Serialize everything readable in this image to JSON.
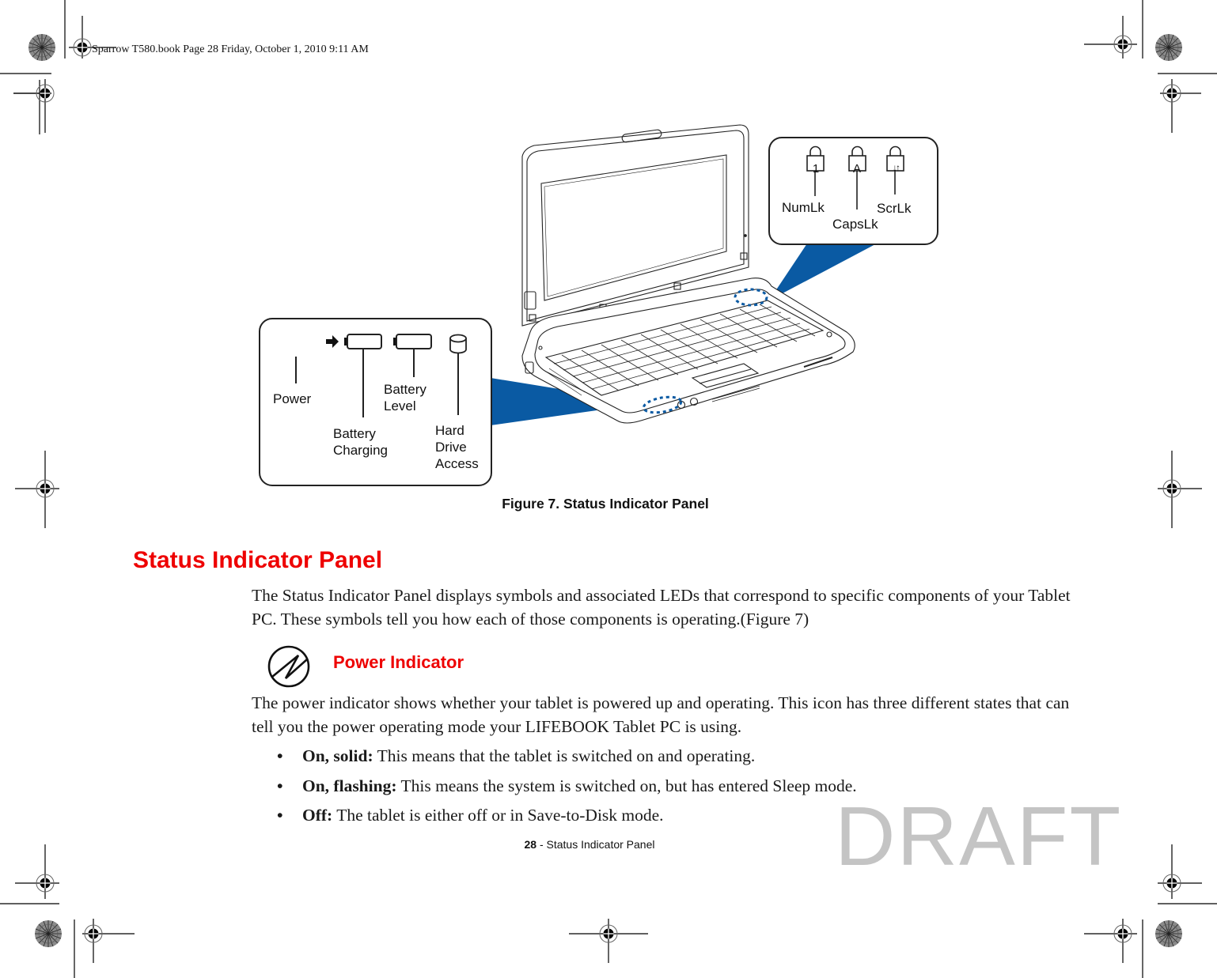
{
  "header": {
    "stamp": "Sparrow T580.book  Page 28  Friday, October 1, 2010  9:11 AM"
  },
  "figure": {
    "caption": "Figure 7.  Status Indicator Panel",
    "top_callout": {
      "icons": [
        "numlock-icon",
        "capslock-icon",
        "scrolllock-icon"
      ],
      "icon_glyphs": [
        "1",
        "A",
        "↓↑"
      ],
      "labels": {
        "numlk": "NumLk",
        "capslk": "CapsLk",
        "scrlk": "ScrLk"
      }
    },
    "bottom_callout": {
      "labels": {
        "power": "Power",
        "battery_charging_1": "Battery",
        "battery_charging_2": "Charging",
        "battery_level_1": "Battery",
        "battery_level_2": "Level",
        "hdd_1": "Hard",
        "hdd_2": "Drive",
        "hdd_3": "Access"
      }
    },
    "accent_color": "#0a5aa3"
  },
  "section": {
    "title": "Status Indicator Panel",
    "intro": "The Status Indicator Panel displays symbols and associated LEDs that correspond to specific components of your Tablet PC. These symbols tell you how each of those components is operating.(Figure 7)",
    "title_color": "#ee0000"
  },
  "subsection": {
    "icon": "power-indicator-icon",
    "title": "Power Indicator",
    "body": "The power indicator shows whether your tablet is powered up and operating. This icon has three different states that can tell you the power operating mode your LIFEBOOK Tablet PC is using.",
    "bullets": [
      {
        "term": "On, solid:",
        "text": " This means that the tablet is switched on and operating."
      },
      {
        "term": "On, flashing:",
        "text": " This means the system is switched on, but has entered Sleep mode."
      },
      {
        "term": "Off:",
        "text": " The tablet is either off or in Save-to-Disk mode."
      }
    ],
    "bullet_glyph": "•"
  },
  "footer": {
    "page_number": "28",
    "separator": " - ",
    "section_name": "Status Indicator Panel"
  },
  "watermark": "DRAFT"
}
